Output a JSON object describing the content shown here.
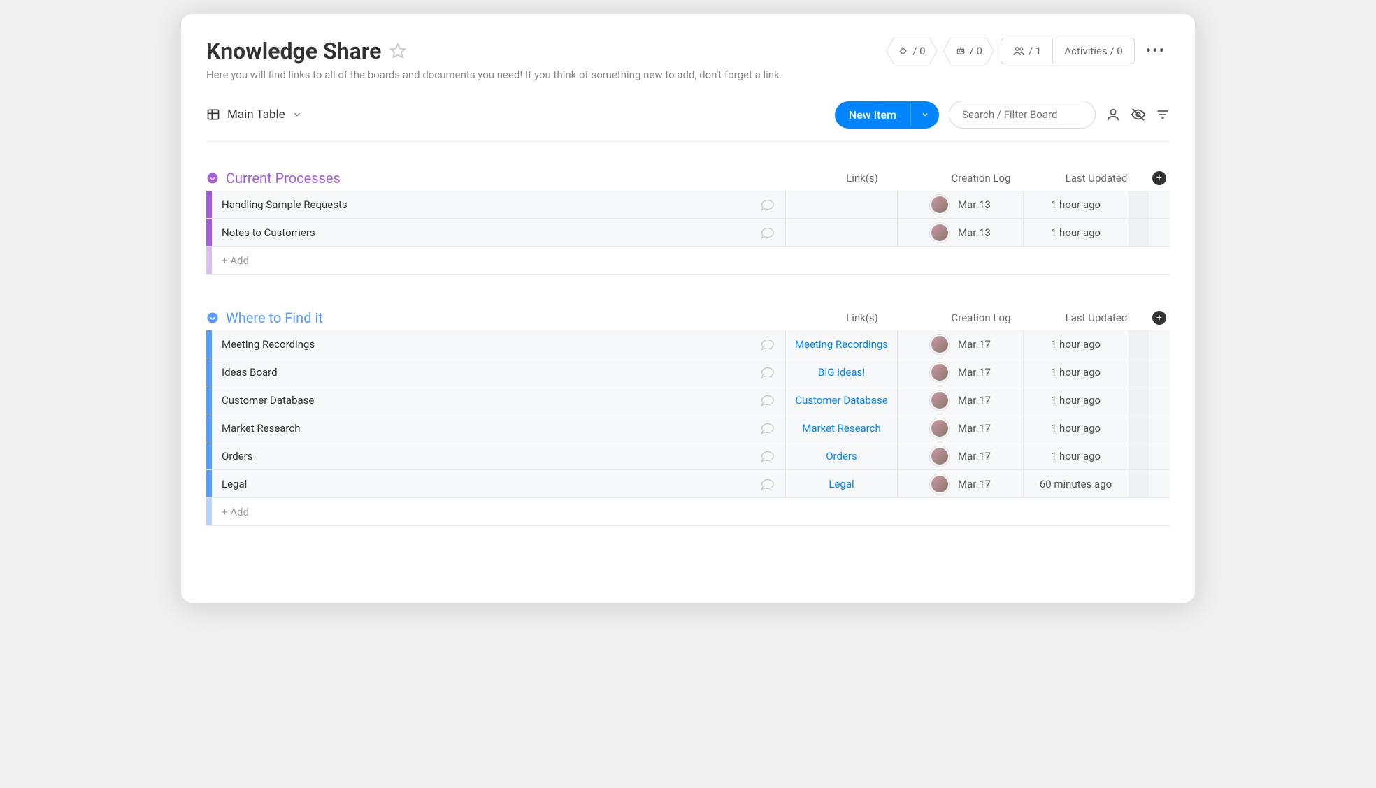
{
  "header": {
    "title": "Knowledge Share",
    "subtitle": "Here you will find links to all of the boards and documents you need! If you think of something new to add, don't forget a link.",
    "integrations_count": "/ 0",
    "automations_count": "/ 0",
    "members_count": "/ 1",
    "activities_label": "Activities / 0"
  },
  "toolbar": {
    "view_label": "Main Table",
    "new_item_label": "New Item",
    "search_placeholder": "Search / Filter Board"
  },
  "columns": {
    "links": "Link(s)",
    "creation_log": "Creation Log",
    "last_updated": "Last Updated"
  },
  "groups": [
    {
      "title": "Current Processes",
      "color_class": "purple",
      "rows": [
        {
          "name": "Handling Sample Requests",
          "link": "",
          "date": "Mar 13",
          "updated": "1 hour ago"
        },
        {
          "name": "Notes to Customers",
          "link": "",
          "date": "Mar 13",
          "updated": "1 hour ago"
        }
      ],
      "add_label": "+ Add"
    },
    {
      "title": "Where to Find it",
      "color_class": "blue",
      "rows": [
        {
          "name": "Meeting Recordings",
          "link": "Meeting Recordings",
          "date": "Mar 17",
          "updated": "1 hour ago"
        },
        {
          "name": "Ideas Board",
          "link": "BIG ideas!",
          "date": "Mar 17",
          "updated": "1 hour ago"
        },
        {
          "name": "Customer Database",
          "link": "Customer Database",
          "date": "Mar 17",
          "updated": "1 hour ago"
        },
        {
          "name": "Market Research",
          "link": "Market Research",
          "date": "Mar 17",
          "updated": "1 hour ago"
        },
        {
          "name": "Orders",
          "link": "Orders",
          "date": "Mar 17",
          "updated": "1 hour ago"
        },
        {
          "name": "Legal",
          "link": "Legal",
          "date": "Mar 17",
          "updated": "60 minutes ago"
        }
      ],
      "add_label": "+ Add"
    }
  ]
}
